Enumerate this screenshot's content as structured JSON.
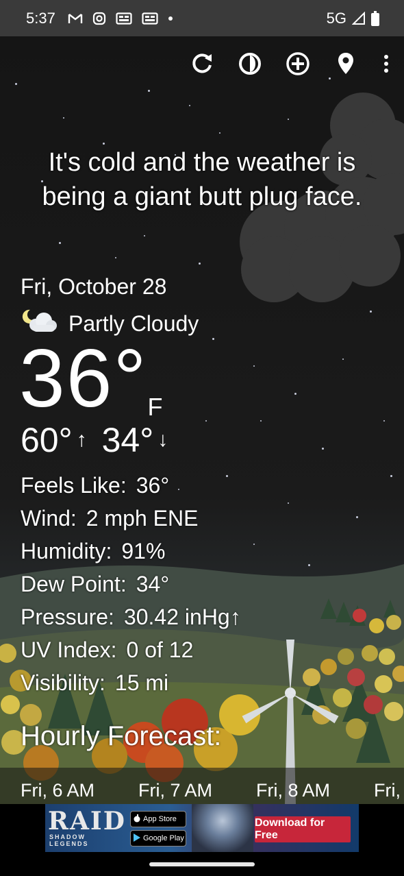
{
  "status_bar": {
    "time": "5:37",
    "network": "5G",
    "icons": [
      "gmail-icon",
      "instagram-icon",
      "news-icon",
      "news-icon",
      "dot-icon",
      "signal-icon",
      "battery-icon"
    ]
  },
  "toolbar": {
    "icons": [
      "refresh-icon",
      "theme-icon",
      "add-location-icon",
      "location-pin-icon",
      "more-vert-icon"
    ]
  },
  "headline": "It's cold and the weather is being a giant butt plug face.",
  "current": {
    "date": "Fri, October 28",
    "condition": "Partly Cloudy",
    "condition_icon": "partly-cloudy-night-icon",
    "temperature": "36°",
    "unit": "F",
    "high": "60°",
    "low": "34°"
  },
  "details": [
    {
      "label": "Feels Like:",
      "value": "36°"
    },
    {
      "label": "Wind:",
      "value": "2 mph ENE"
    },
    {
      "label": "Humidity:",
      "value": "91%"
    },
    {
      "label": "Dew Point:",
      "value": "34°"
    },
    {
      "label": "Pressure:",
      "value": "30.42 inHg↑"
    },
    {
      "label": "UV Index:",
      "value": "0 of 12"
    },
    {
      "label": "Visibility:",
      "value": "15 mi"
    }
  ],
  "hourly": {
    "title": "Hourly Forecast:",
    "hours": [
      "Fri, 6 AM",
      "Fri, 7 AM",
      "Fri, 8 AM",
      "Fri,"
    ]
  },
  "ad": {
    "logo_title": "RAID",
    "logo_subtitle": "SHADOW LEGENDS",
    "app_store": "App Store",
    "google_play": "Google Play",
    "cta": "Download for Free"
  },
  "colors": {
    "status_bar": "#3a3a3a",
    "sky": "#151515",
    "ad_cta": "#c7263a"
  }
}
